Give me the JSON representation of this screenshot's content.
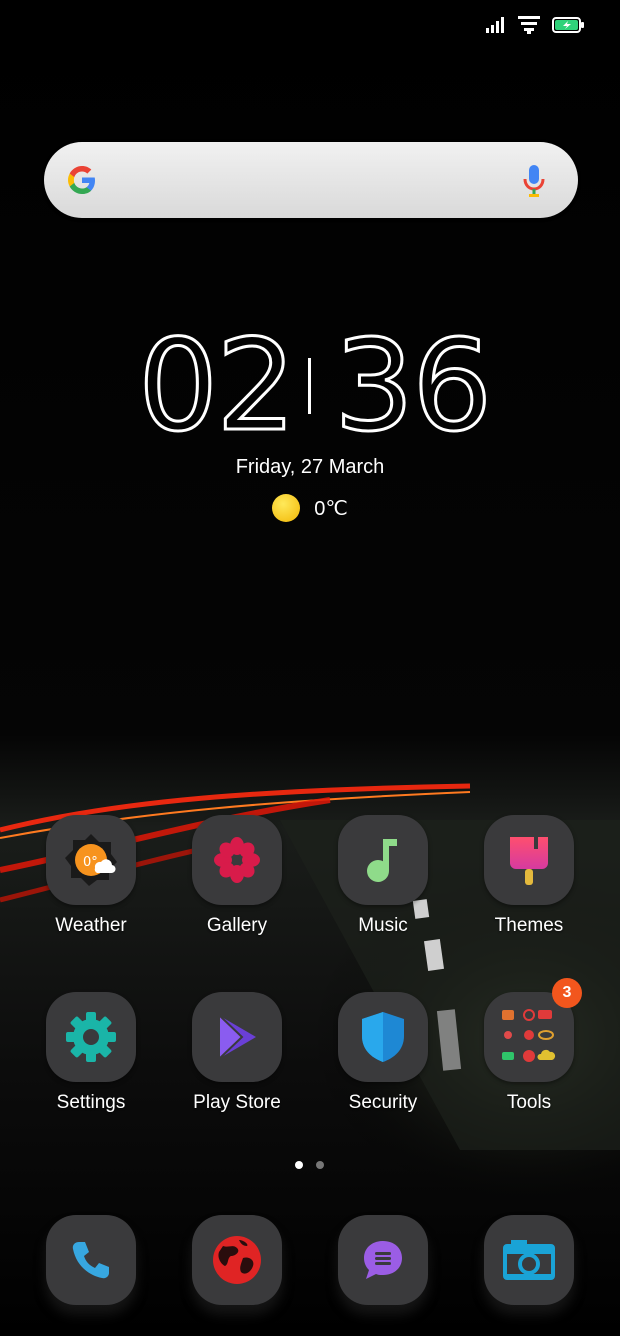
{
  "status_bar": {
    "icons": [
      "signal-icon",
      "wifi-icon",
      "battery-charging-icon"
    ]
  },
  "search": {
    "icon": "google-g-icon",
    "mic_icon": "mic-icon"
  },
  "clock": {
    "hours": "02",
    "minutes": "36"
  },
  "date": "Friday, 27 March",
  "weather": {
    "icon": "sun-icon",
    "temp": "0℃"
  },
  "apps": [
    {
      "label": "Weather",
      "icon": "weather-icon"
    },
    {
      "label": "Gallery",
      "icon": "gallery-flower-icon"
    },
    {
      "label": "Music",
      "icon": "music-note-icon"
    },
    {
      "label": "Themes",
      "icon": "brush-icon"
    },
    {
      "label": "Settings",
      "icon": "gear-icon"
    },
    {
      "label": "Play Store",
      "icon": "play-store-icon"
    },
    {
      "label": "Security",
      "icon": "shield-icon"
    },
    {
      "label": "Tools",
      "icon": "folder-icon",
      "badge": "3"
    }
  ],
  "page_indicator": {
    "pages": 2,
    "active": 1
  },
  "dock": [
    {
      "icon": "phone-icon"
    },
    {
      "icon": "browser-globe-icon"
    },
    {
      "icon": "messages-icon"
    },
    {
      "icon": "camera-icon"
    }
  ],
  "colors": {
    "tile_bg": "#3a3a3c",
    "badge": "#f2561d",
    "accent_teal": "#1ab5a8",
    "light_trail": "#ff2a10"
  }
}
